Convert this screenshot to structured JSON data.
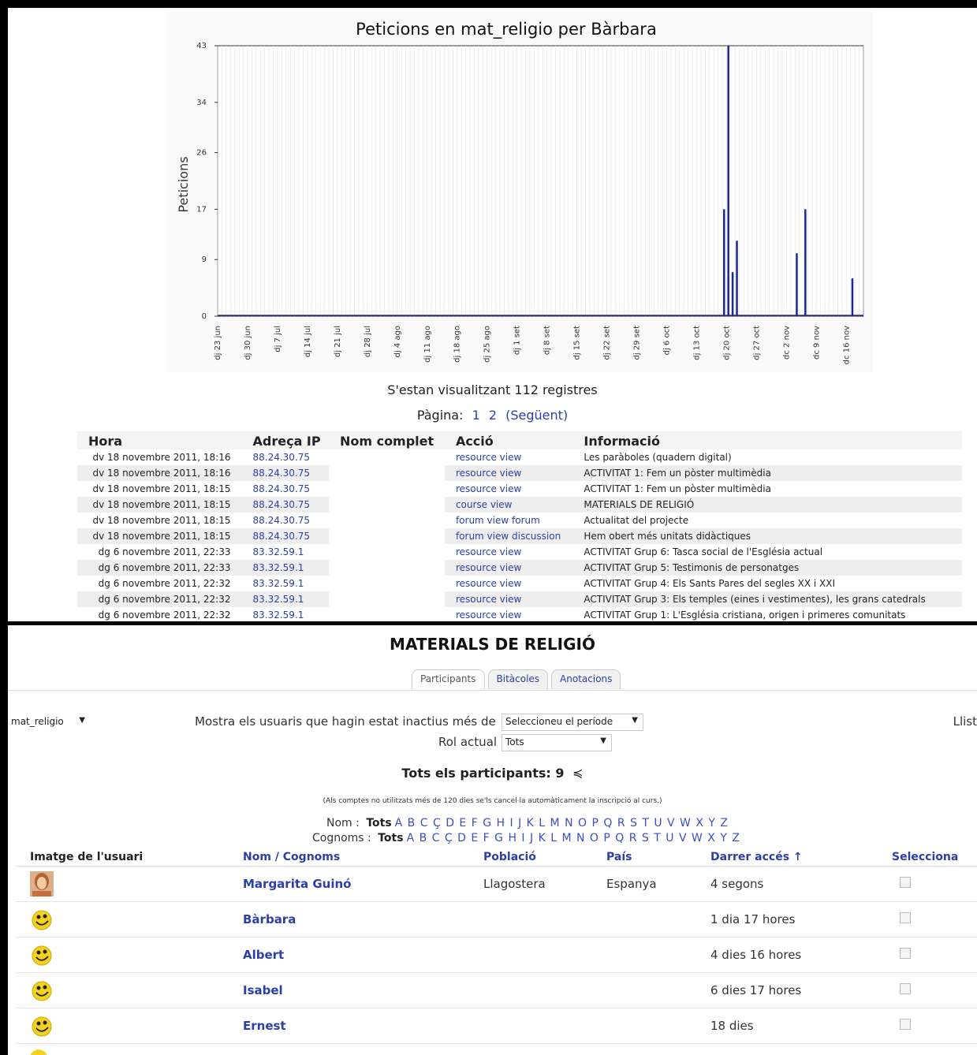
{
  "chart_data": {
    "type": "bar",
    "title": "Peticions en mat_religio per Bàrbara",
    "ylabel": "Peticions",
    "xlabel": "",
    "ylim": [
      0,
      43
    ],
    "yticks": [
      0,
      9,
      17,
      26,
      34,
      43
    ],
    "grid": true,
    "x_labels": [
      "dj 23 jun",
      "dj 30 jun",
      "dj 7 jul",
      "dj 14 jul",
      "dj 21 jul",
      "dj 28 jul",
      "dj 4 ago",
      "dj 11 ago",
      "dj 18 ago",
      "dj 25 ago",
      "dj 1 set",
      "dj 8 set",
      "dj 15 set",
      "dj 22 set",
      "dj 29 set",
      "dj 6 oct",
      "dj 13 oct",
      "dj 20 oct",
      "dj 27 oct",
      "dc 2 nov",
      "dc 9 nov",
      "dc 16 nov"
    ],
    "bars": [
      {
        "day": 118,
        "value": 17
      },
      {
        "day": 119,
        "value": 43
      },
      {
        "day": 120,
        "value": 7
      },
      {
        "day": 121,
        "value": 12
      },
      {
        "day": 135,
        "value": 10
      },
      {
        "day": 137,
        "value": 17
      },
      {
        "day": 148,
        "value": 6
      }
    ]
  },
  "log": {
    "records_text": "S'estan visualitzant 112 registres",
    "page_label": "Pàgina:",
    "pages": [
      "1",
      "2"
    ],
    "next_label": "(Següent)",
    "headers": [
      "Hora",
      "Adreça IP",
      "Nom complet",
      "Acció",
      "Informació"
    ],
    "rows": [
      {
        "time": "dv 18 novembre 2011, 18:16",
        "ip": "88.24.30.75",
        "action": "resource view",
        "info": "Les paràboles (quadern digital)"
      },
      {
        "time": "dv 18 novembre 2011, 18:16",
        "ip": "88.24.30.75",
        "action": "resource view",
        "info": "ACTIVITAT 1: Fem un pòster multimèdia"
      },
      {
        "time": "dv 18 novembre 2011, 18:15",
        "ip": "88.24.30.75",
        "action": "resource view",
        "info": "ACTIVITAT 1: Fem un pòster multimèdia"
      },
      {
        "time": "dv 18 novembre 2011, 18:15",
        "ip": "88.24.30.75",
        "action": "course view",
        "info": "MATERIALS DE RELIGIÓ"
      },
      {
        "time": "dv 18 novembre 2011, 18:15",
        "ip": "88.24.30.75",
        "action": "forum view forum",
        "info": "Actualitat del projecte"
      },
      {
        "time": "dv 18 novembre 2011, 18:15",
        "ip": "88.24.30.75",
        "action": "forum view discussion",
        "info": "Hem obert més unitats didàctiques"
      },
      {
        "time": "dg 6 novembre 2011, 22:33",
        "ip": "83.32.59.1",
        "action": "resource view",
        "info": "ACTIVITAT Grup 6: Tasca social de l'Església actual"
      },
      {
        "time": "dg 6 novembre 2011, 22:33",
        "ip": "83.32.59.1",
        "action": "resource view",
        "info": "ACTIVITAT Grup 5: Testimonis de personatges"
      },
      {
        "time": "dg 6 novembre 2011, 22:32",
        "ip": "83.32.59.1",
        "action": "resource view",
        "info": "ACTIVITAT Grup 4: Els Sants Pares del segles XX i XXI"
      },
      {
        "time": "dg 6 novembre 2011, 22:32",
        "ip": "83.32.59.1",
        "action": "resource view",
        "info": "ACTIVITAT Grup 3: Els temples (eines i vestimentes), les grans catedrals"
      },
      {
        "time": "dg 6 novembre 2011, 22:32",
        "ip": "83.32.59.1",
        "action": "resource view",
        "info": "ACTIVITAT Grup 1: L'Església cristiana, origen i primeres comunitats"
      }
    ]
  },
  "participants": {
    "course_title": "MATERIALS DE RELIGIÓ",
    "tabs": [
      "Participants",
      "Bitàcoles",
      "Anotacions"
    ],
    "active_tab": 0,
    "course_select": "mat_religio",
    "inactive_label": "Mostra els usuaris que hagin estat inactius més de",
    "period_select": "Seleccioneu el període",
    "list_label": "Llist",
    "role_label": "Rol actual",
    "role_select": "Tots",
    "count_text": "Tots els participants: 9",
    "note": "(Als comptes no utilitzats més de 120 dies se'ls cancel·la automàticament la inscripció al curs.)",
    "filter_nom_label": "Nom",
    "filter_cognoms_label": "Cognoms",
    "filter_all": "Tots",
    "letters": "A B C Ç D E F G H I J K L M N O P Q R S T U V W X Y Z",
    "headers": {
      "image": "Imatge de l'usuari",
      "name": "Nom / Cognoms",
      "city": "Població",
      "country": "País",
      "last": "Darrer accés ↑",
      "select": "Selecciona"
    },
    "users": [
      {
        "name": "Margarita Guinó",
        "city": "Llagostera",
        "country": "Espanya",
        "last": "4 segons",
        "avatar": "photo"
      },
      {
        "name": "Bàrbara",
        "city": "",
        "country": "",
        "last": "1 dia 17 hores",
        "avatar": "smiley"
      },
      {
        "name": "Albert",
        "city": "",
        "country": "",
        "last": "4 dies 16 hores",
        "avatar": "smiley"
      },
      {
        "name": "Isabel",
        "city": "",
        "country": "",
        "last": "6 dies 17 hores",
        "avatar": "smiley"
      },
      {
        "name": "Ernest",
        "city": "",
        "country": "",
        "last": "18 dies",
        "avatar": "smiley"
      }
    ]
  }
}
